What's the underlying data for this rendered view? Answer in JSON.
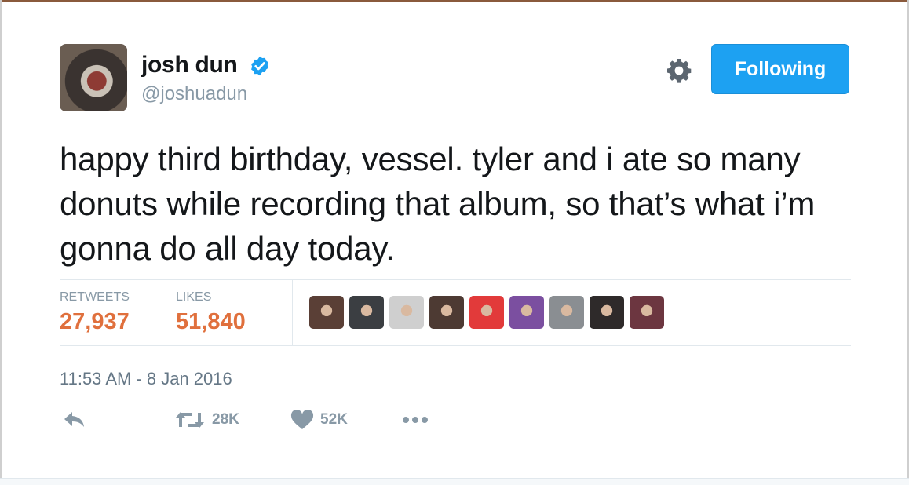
{
  "user": {
    "display_name": "josh dun",
    "handle": "@joshuadun",
    "verified_icon": "verified-badge-icon"
  },
  "header": {
    "settings_icon": "gear-icon",
    "follow_label": "Following"
  },
  "tweet": {
    "text": "happy third birthday, vessel. tyler and i ate so many donuts while recording that album, so that’s what i’m gonna do all day today.",
    "timestamp": "11:53 AM - 8 Jan 2016"
  },
  "stats": {
    "retweets_label": "RETWEETS",
    "retweets_value": "27,937",
    "likes_label": "LIKES",
    "likes_value": "51,840"
  },
  "likers": {
    "count_shown": 9,
    "colors": [
      "#5a3f36",
      "#3b3e42",
      "#cfcfcf",
      "#4d3a33",
      "#e23a3a",
      "#7b4fa0",
      "#8a8e92",
      "#2e2a2a",
      "#6c3640"
    ]
  },
  "actions": {
    "reply_icon": "reply-icon",
    "retweet_icon": "retweet-icon",
    "retweet_count": "28K",
    "like_icon": "heart-icon",
    "like_count": "52K",
    "more_icon": "more-dots-icon"
  },
  "colors": {
    "accent_blue": "#1da1f2",
    "stat_orange": "#e0703d",
    "muted_gray": "#8899a6",
    "text_dark": "#14171a"
  }
}
